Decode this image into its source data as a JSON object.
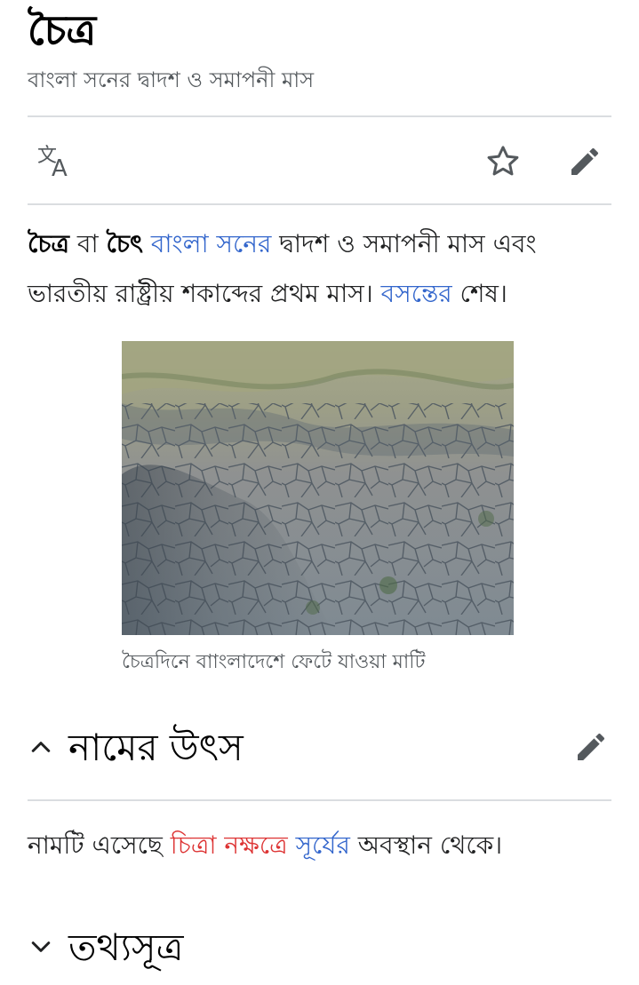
{
  "article": {
    "title": "চৈত্র",
    "description": "বাংলা সনের দ্বাদশ ও সমাপনী মাস"
  },
  "icons": {
    "language": "translate-icon",
    "watch": "star-outline-icon",
    "edit": "pencil-icon",
    "collapse": "chevron-up-icon",
    "expand": "chevron-down-icon"
  },
  "lead": {
    "term1": "চৈত্র",
    "text1": " বা ",
    "term2": "চৈৎ",
    "text2": " ",
    "link1": "বাংলা সনের",
    "text3": " দ্বাদশ ও সমাপনী মাস এবং ভারতীয় রাষ্ট্রীয় শকাব্দের প্রথম মাস। ",
    "link2": "বসন্তের",
    "text4": " শেষ।"
  },
  "figure": {
    "caption": "চৈত্রদিনে বাাংলাদেশে ফেটে যাওয়া মাটি"
  },
  "sections": [
    {
      "heading": "নামের উৎস",
      "expanded": true,
      "text1": "নামটি এসেছে ",
      "red_link": "চিত্রা নক্ষত্রে",
      "text2": " ",
      "link": "সূর্যের",
      "text3": " অবস্থান থেকে।"
    },
    {
      "heading": "তথ্যসূত্র",
      "expanded": false
    }
  ],
  "colors": {
    "link": "#3366cc",
    "red_link": "#dd3333",
    "text": "#202122",
    "subtle_text": "#54595d",
    "divider": "#dadde0",
    "icon": "#54595d"
  }
}
